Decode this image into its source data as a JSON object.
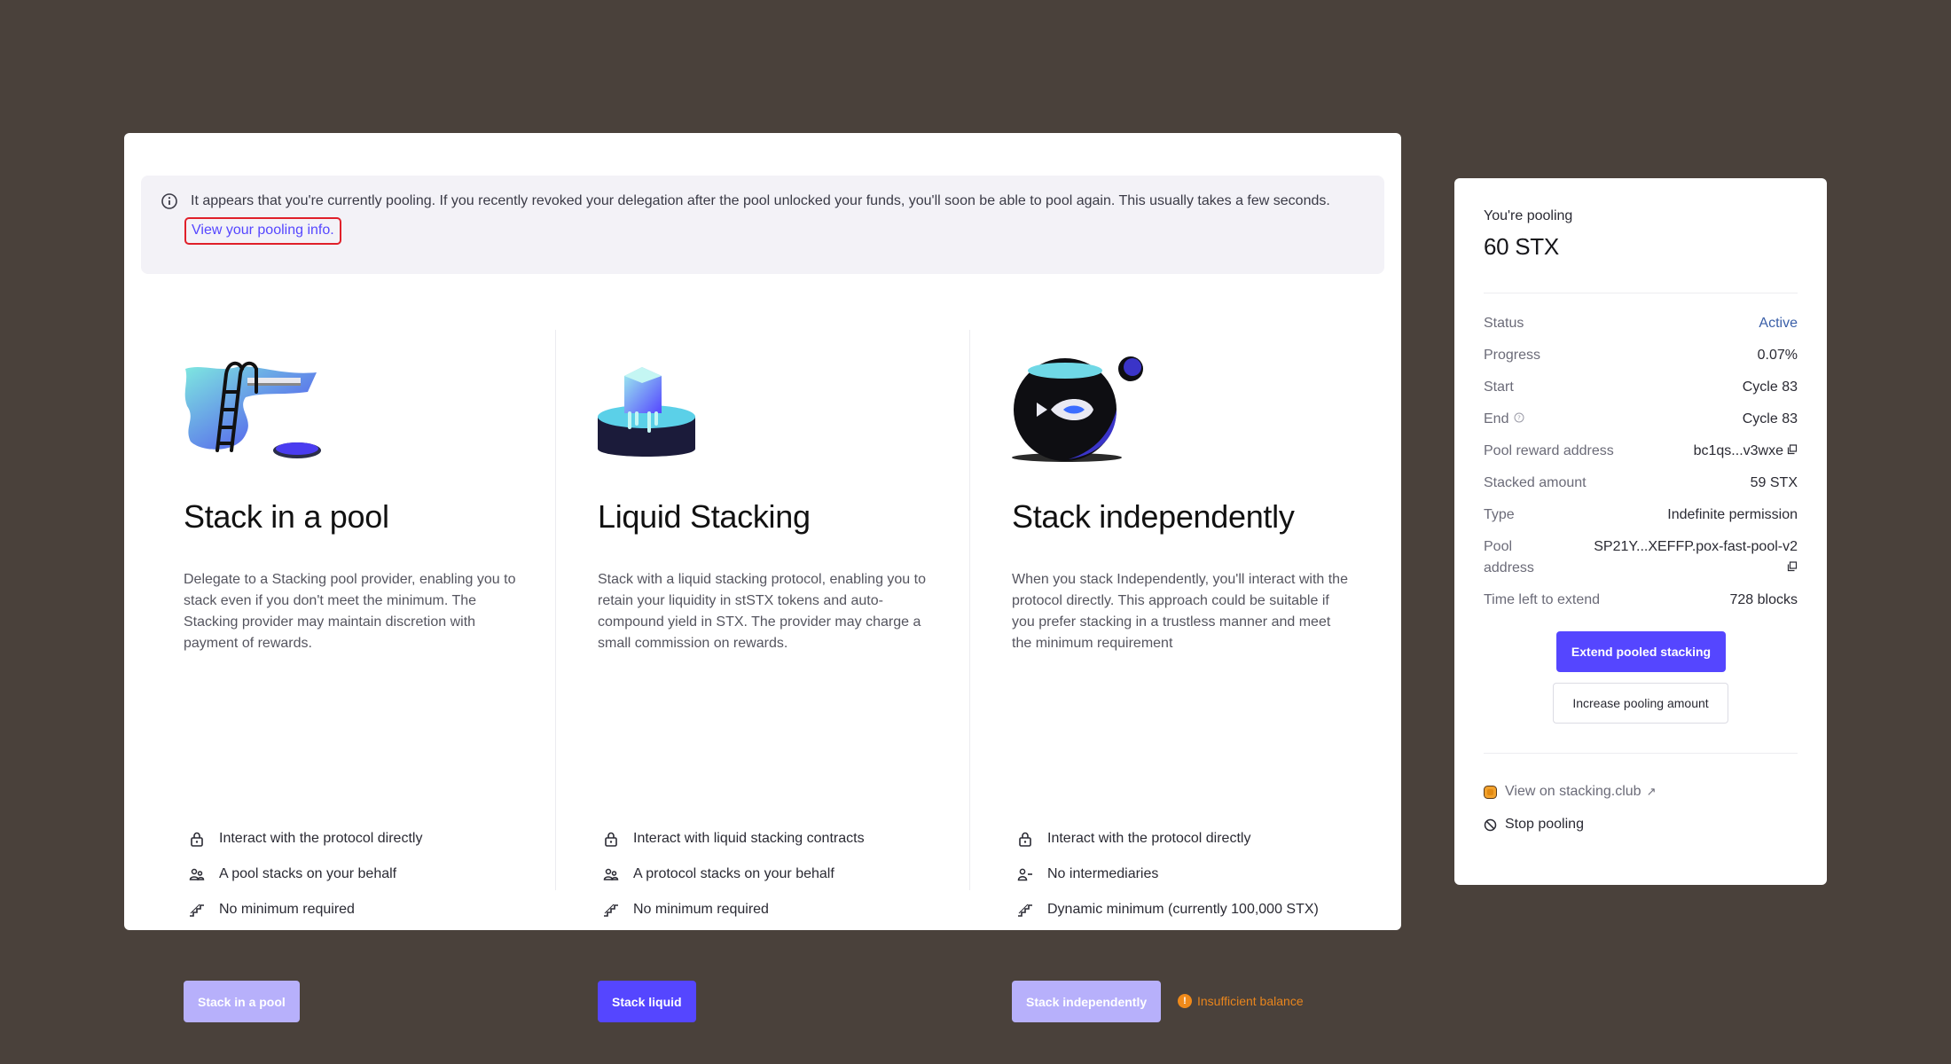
{
  "banner": {
    "icon": "info-icon",
    "text": "It appears that you're currently pooling. If you recently revoked your delegation after the pool unlocked your funds, you'll soon be able to pool again. This usually takes a few seconds.",
    "link": "View your pooling info."
  },
  "columns": [
    {
      "title": "Stack in a pool",
      "description": "Delegate to a Stacking pool provider, enabling you to stack even if you don't meet the minimum. The Stacking provider may maintain discretion with payment of rewards.",
      "features": [
        {
          "icon": "lock-icon",
          "label": "Interact with the protocol directly"
        },
        {
          "icon": "people-icon",
          "label": "A pool stacks on your behalf"
        },
        {
          "icon": "stairs-icon",
          "label": "No minimum required"
        }
      ],
      "button": "Stack in a pool",
      "button_state": "disabled"
    },
    {
      "title": "Liquid Stacking",
      "description": "Stack with a liquid stacking protocol, enabling you to retain your liquidity in stSTX tokens and auto-compound yield in STX. The provider may charge a small commission on rewards.",
      "features": [
        {
          "icon": "lock-icon",
          "label": "Interact with liquid stacking contracts"
        },
        {
          "icon": "people-icon",
          "label": "A protocol stacks on your behalf"
        },
        {
          "icon": "stairs-icon",
          "label": "No minimum required"
        }
      ],
      "button": "Stack liquid",
      "button_state": "enabled"
    },
    {
      "title": "Stack independently",
      "description": "When you stack Independently, you'll interact with the protocol directly. This approach could be suitable if you prefer stacking in a trustless manner and meet the minimum requirement",
      "features": [
        {
          "icon": "lock-icon",
          "label": "Interact with the protocol directly"
        },
        {
          "icon": "person-minus-icon",
          "label": "No intermediaries"
        },
        {
          "icon": "stairs-icon",
          "label": "Dynamic minimum (currently 100,000 STX)"
        }
      ],
      "button": "Stack independently",
      "button_state": "disabled",
      "warning": "Insufficient balance"
    }
  ],
  "pooling": {
    "label": "You're pooling",
    "amount": "60 STX",
    "rows": [
      {
        "key": "Status",
        "value": "Active"
      },
      {
        "key": "Progress",
        "value": "0.07%"
      },
      {
        "key": "Start",
        "value": "Cycle 83"
      },
      {
        "key": "End",
        "value": "Cycle 83"
      },
      {
        "key": "Pool reward address",
        "value": "bc1qs...v3wxe"
      },
      {
        "key": "Stacked amount",
        "value": "59 STX"
      },
      {
        "key": "Type",
        "value": "Indefinite permission"
      },
      {
        "key": "Pool address",
        "value": "SP21Y...XEFFP.pox-fast-pool-v2"
      },
      {
        "key": "Time left to extend",
        "value": "728 blocks"
      }
    ],
    "extend_button": "Extend pooled stacking",
    "increase_button": "Increase pooling amount",
    "view_link": "View on stacking.club",
    "stop_link": "Stop pooling"
  },
  "colors": {
    "background": "#4a413b",
    "accent": "#5546ff",
    "accent_disabled": "#b7b0fb",
    "warning": "#e8851d",
    "status_active": "#3a5fa8"
  }
}
